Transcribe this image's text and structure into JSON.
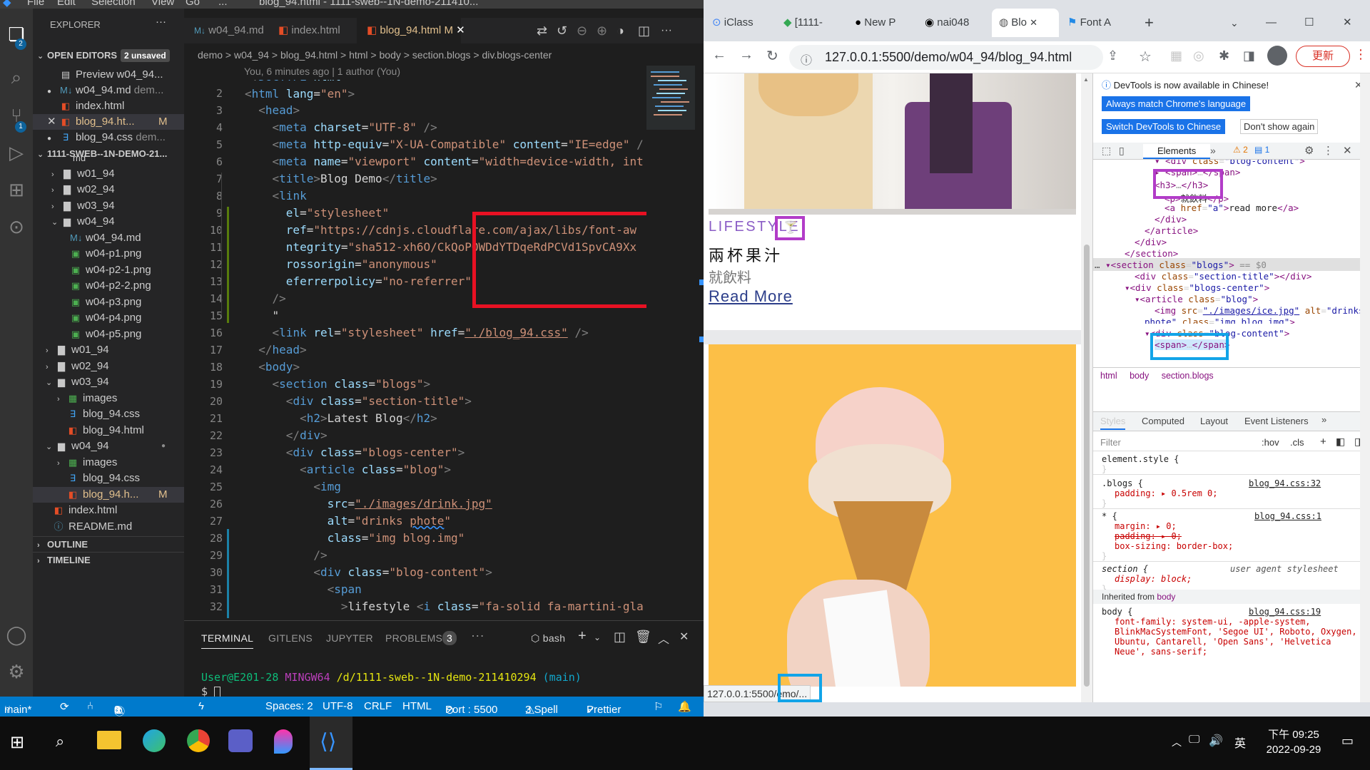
{
  "vscode": {
    "title_bar": {
      "menus": [
        "File",
        "Edit",
        "Selection",
        "View",
        "Go",
        "..."
      ],
      "title": "blog_94.html - 1111-sweb--1N-demo-211410..."
    },
    "activity_badges": {
      "explorer": "2",
      "scm": "1"
    },
    "sidebar": {
      "header": "EXPLORER",
      "open_editors": "OPEN EDITORS",
      "unsaved": "2 unsaved",
      "open_items": [
        {
          "label": "Preview w04_94...",
          "close": "",
          "mod": ""
        },
        {
          "label": "w04_94.md",
          "extra": "dem...",
          "close": "●"
        },
        {
          "label": "index.html",
          "close": ""
        },
        {
          "label": "blog_94.ht...",
          "close": "✕",
          "mod": "M"
        },
        {
          "label": "blog_94.css",
          "extra": "dem...",
          "close": "●"
        }
      ],
      "workspace": "1111-SWEB--1N-DEMO-21...",
      "tree": [
        {
          "label": "md",
          "depth": 1
        },
        {
          "label": "w01_94",
          "depth": 2
        },
        {
          "label": "w02_94",
          "depth": 2
        },
        {
          "label": "w03_94",
          "depth": 2
        },
        {
          "label": "w04_94",
          "depth": 2
        },
        {
          "label": "w04_94.md",
          "depth": 3
        },
        {
          "label": "w04-p1.png",
          "depth": 3
        },
        {
          "label": "w04-p2-1.png",
          "depth": 3
        },
        {
          "label": "w04-p2-2.png",
          "depth": 3
        },
        {
          "label": "w04-p3.png",
          "depth": 3
        },
        {
          "label": "w04-p4.png",
          "depth": 3
        },
        {
          "label": "w04-p5.png",
          "depth": 3
        },
        {
          "label": "w01_94",
          "depth": 1
        },
        {
          "label": "w02_94",
          "depth": 1
        },
        {
          "label": "w03_94",
          "depth": 1
        },
        {
          "label": "images",
          "depth": 2
        },
        {
          "label": "blog_94.css",
          "depth": 2
        },
        {
          "label": "blog_94.html",
          "depth": 2
        },
        {
          "label": "w04_94",
          "depth": 1
        },
        {
          "label": "images",
          "depth": 2
        },
        {
          "label": "blog_94.css",
          "depth": 2
        },
        {
          "label": "blog_94.h...",
          "depth": 2,
          "mod": "M"
        },
        {
          "label": "index.html",
          "depth": 1
        },
        {
          "label": "README.md",
          "depth": 1
        }
      ],
      "outline": "OUTLINE",
      "timeline": "TIMELINE"
    },
    "tabs": [
      {
        "label": "w04_94.md"
      },
      {
        "label": "index.html"
      },
      {
        "label": "blog_94.html",
        "mod": "M",
        "close": "✕"
      }
    ],
    "breadcrumb": "demo > w04_94 > blog_94.html > html > body > section.blogs > div.blogs-center",
    "blame": "You, 6 minutes ago | 1 author (You)",
    "line_numbers": [
      "1",
      "2",
      "3",
      "4",
      "5",
      "6",
      "7",
      "8",
      "9",
      "10",
      "11",
      "12",
      "13",
      "14",
      "15",
      "16",
      "17",
      "18",
      "19",
      "20",
      "21",
      "22",
      "23",
      "24",
      "25",
      "26",
      "27",
      "28",
      "29",
      "30",
      "31",
      "32"
    ],
    "panel": {
      "tabs": [
        "TERMINAL",
        "GITLENS",
        "JUPYTER",
        "PROBLEMS"
      ],
      "problems_count": "3",
      "shell": "bash",
      "prompt_user": "User@E201-28",
      "prompt_env": "MINGW64",
      "prompt_path": "/d/1111-sweb--1N-demo-211410294",
      "prompt_branch": "(main)",
      "prompt_symbol": "$"
    },
    "status": {
      "branch": "main*",
      "errors": "0",
      "warnings": "0",
      "info": "3",
      "spaces": "Spaces: 2",
      "encoding": "UTF-8",
      "eol": "CRLF",
      "lang": "HTML",
      "port": "Port : 5500",
      "spell": "3 Spell",
      "prettier": "Prettier"
    }
  },
  "chrome": {
    "tabs": [
      "iClass",
      "[1111-",
      "New P",
      "nai048",
      "Blo",
      "Font A"
    ],
    "url": "127.0.0.1:5500/demo/w04_94/blog_94.html",
    "update_btn": "更新",
    "page": {
      "category": "LIFESTYLE",
      "post_title": "兩杯果汁",
      "post_text": "就飲料",
      "read_more": "Read More",
      "status_url": "127.0.0.1:5500/",
      "status_url_tail": "emo/..."
    },
    "devtools": {
      "info": "DevTools is now available in Chinese!",
      "btn_match": "Always match Chrome's language",
      "btn_switch": "Switch DevTools to Chinese",
      "btn_dont": "Don't show again",
      "elements_tab": "Elements",
      "warn_count": "2",
      "msg_count": "1",
      "crumbs": [
        "html",
        "body",
        "section.blogs"
      ],
      "styles_tabs": [
        "Styles",
        "Computed",
        "Layout",
        "Event Listeners"
      ],
      "filter": "Filter",
      "hov": ":hov",
      "cls": ".cls",
      "rules": [
        {
          "sel": "element.style {",
          "src": ""
        },
        {
          "sel": ".blogs {",
          "src": "blog_94.css:32",
          "props": [
            "padding: ▸ 0.5rem 0;"
          ]
        },
        {
          "sel": "* {",
          "src": "blog_94.css:1",
          "props": [
            "margin: ▸ 0;",
            "padding: ▸ 0;",
            "box-sizing: border-box;"
          ]
        },
        {
          "sel": "section {",
          "src": "user agent stylesheet",
          "props": [
            "display: block;"
          ]
        }
      ],
      "inherited": "Inherited from",
      "inherited_el": "body",
      "body_rule_src": "blog_94.css:19",
      "body_font": "font-family: system-ui, -apple-system, BlinkMacSystemFont, 'Segoe UI', Roboto, Oxygen, Ubuntu, Cantarell, 'Open Sans', 'Helvetica Neue', sans-serif;"
    }
  },
  "taskbar": {
    "time": "下午 09:25",
    "date": "2022-09-29",
    "ime": "英"
  },
  "colors": {
    "vscode_blue": "#007acc",
    "annot_red": "#e81123",
    "annot_purple": "#b23cc8",
    "annot_cyan": "#12a4e8"
  }
}
